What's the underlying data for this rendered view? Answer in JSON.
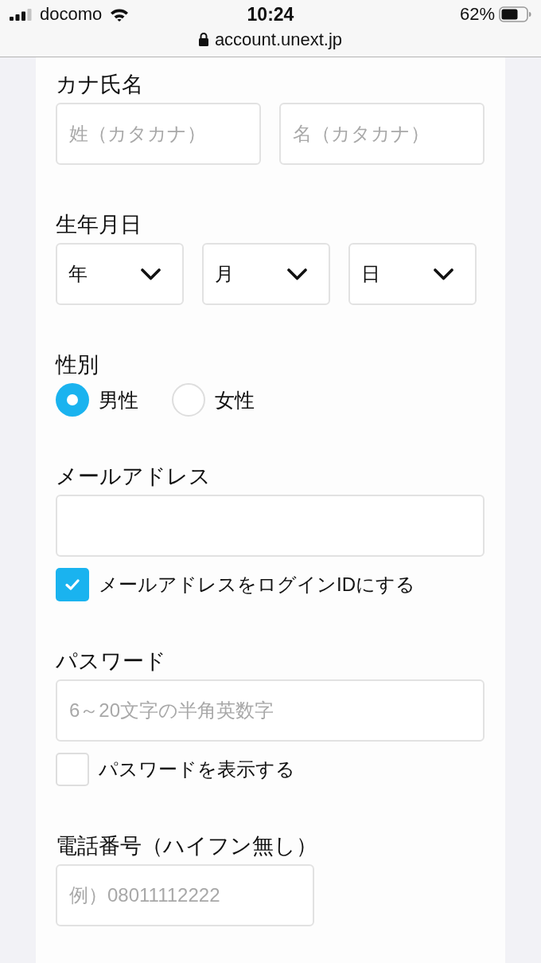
{
  "status_bar": {
    "carrier": "docomo",
    "time": "10:24",
    "battery": "62%"
  },
  "address_bar": {
    "url": "account.unext.jp"
  },
  "form": {
    "fields": [
      {
        "kind": "name_pair",
        "label": "カナ氏名",
        "inputs": [
          {
            "placeholder": "姓（カタカナ）"
          },
          {
            "placeholder": "名（カタカナ）"
          }
        ]
      },
      {
        "kind": "date_selects",
        "label": "生年月日",
        "selects": [
          {
            "value": "年"
          },
          {
            "value": "月"
          },
          {
            "value": "日"
          }
        ]
      },
      {
        "kind": "radio_group",
        "label": "性別",
        "options": [
          {
            "label": "男性",
            "selected": true
          },
          {
            "label": "女性",
            "selected": false
          }
        ]
      },
      {
        "kind": "text_input",
        "label": "メールアドレス",
        "checkbox": {
          "label": "メールアドレスをログインIDにする",
          "checked": true
        }
      },
      {
        "kind": "text_input",
        "label": "パスワード",
        "placeholder": "6～20文字の半角英数字",
        "checkbox": {
          "label": "パスワードを表示する",
          "checked": false
        }
      },
      {
        "kind": "short_input",
        "label": "電話番号（ハイフン無し）",
        "placeholder": "例）08011112222"
      }
    ]
  }
}
